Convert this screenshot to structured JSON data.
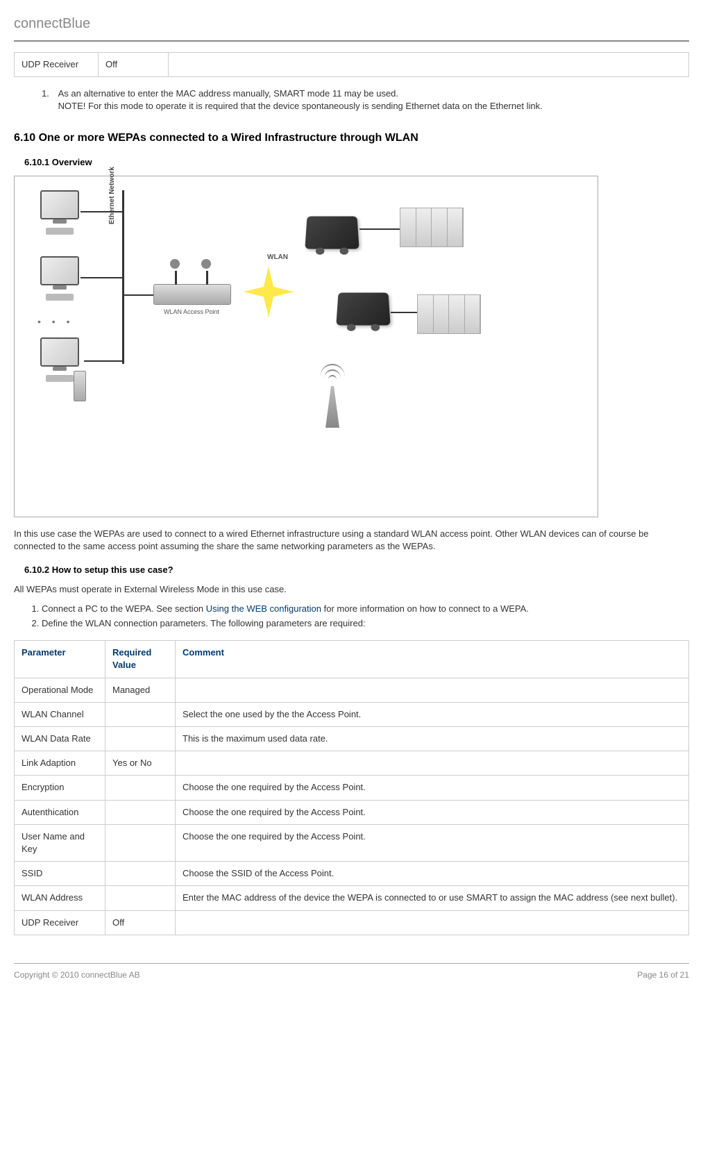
{
  "header": {
    "brand": "connectBlue"
  },
  "top_table": {
    "rows": [
      {
        "param": "UDP Receiver",
        "value": "Off",
        "comment": ""
      }
    ]
  },
  "note1": {
    "num": "1.",
    "line1": "As an alternative to enter the MAC address manually, SMART mode 11 may be used.",
    "line2": "NOTE! For this mode to operate it is required that the device spontaneously is sending Ethernet data on the Ethernet link."
  },
  "section_heading": "6.10 One or more WEPAs connected to a Wired Infrastructure through WLAN",
  "overview_heading": "6.10.1 Overview",
  "diagram": {
    "eth_label": "Ethernet Network",
    "ap_label": "WLAN Access Point",
    "wlan_label": "WLAN"
  },
  "overview_paragraph": "In this use case the WEPAs are used to connect to a wired Ethernet infrastructure using a standard WLAN access point. Other WLAN devices can of course be connected to the same access point assuming the share the same networking parameters as the WEPAs.",
  "howto_heading": "6.10.2 How to setup this use case?",
  "howto_intro": "All WEPAs must operate in External Wireless Mode in this use case.",
  "steps": {
    "s1a": "Connect a PC to the WEPA. See section ",
    "s1link": "Using the WEB configuration",
    "s1b": " for more information on how to connect to a WEPA.",
    "s2": "Define the WLAN connection parameters. The following parameters are required:"
  },
  "param_table": {
    "headers": {
      "c1": "Parameter",
      "c2": "Required Value",
      "c3": "Comment"
    },
    "rows": [
      {
        "param": "Operational Mode",
        "value": "Managed",
        "comment": ""
      },
      {
        "param": "WLAN Channel",
        "value": "",
        "comment": "Select the one used by the the Access Point."
      },
      {
        "param": "WLAN Data Rate",
        "value": "",
        "comment": "This is the maximum used data rate."
      },
      {
        "param": "Link Adaption",
        "value": "Yes or No",
        "comment": ""
      },
      {
        "param": "Encryption",
        "value": "",
        "comment": "Choose the one required by the Access Point."
      },
      {
        "param": "Autenthication",
        "value": "",
        "comment": "Choose the one required by the Access Point."
      },
      {
        "param": "User Name and Key",
        "value": "",
        "comment": "Choose the one required by the Access Point."
      },
      {
        "param": "SSID",
        "value": "",
        "comment": "Choose the SSID of the Access Point."
      },
      {
        "param": "WLAN Address",
        "value": "",
        "comment": "Enter the MAC address of the device the WEPA is connected to or use SMART to assign the MAC address (see next bullet)."
      },
      {
        "param": "UDP Receiver",
        "value": "Off",
        "comment": ""
      }
    ]
  },
  "footer": {
    "copyright": "Copyright © 2010 connectBlue AB",
    "page": "Page 16 of 21"
  }
}
